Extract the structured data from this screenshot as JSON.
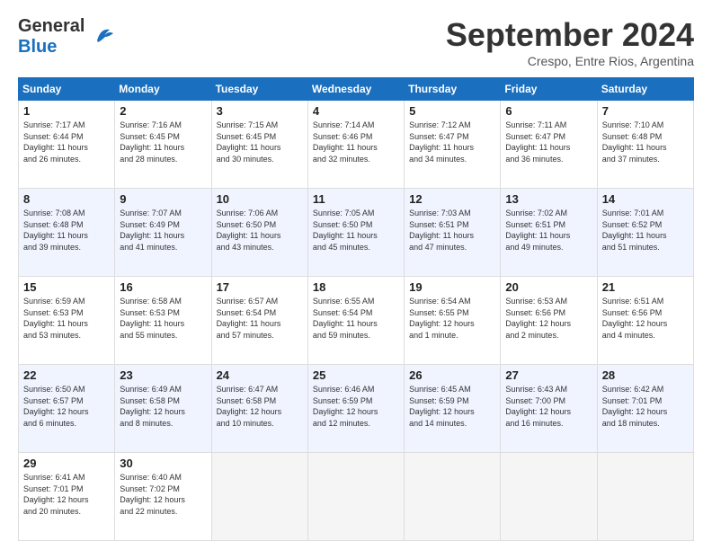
{
  "header": {
    "logo_line1": "General",
    "logo_line2": "Blue",
    "month": "September 2024",
    "location": "Crespo, Entre Rios, Argentina"
  },
  "weekdays": [
    "Sunday",
    "Monday",
    "Tuesday",
    "Wednesday",
    "Thursday",
    "Friday",
    "Saturday"
  ],
  "weeks": [
    [
      {
        "day": "1",
        "sunrise": "Sunrise: 7:17 AM",
        "sunset": "Sunset: 6:44 PM",
        "daylight": "Daylight: 11 hours",
        "daylight2": "and 26 minutes."
      },
      {
        "day": "2",
        "sunrise": "Sunrise: 7:16 AM",
        "sunset": "Sunset: 6:45 PM",
        "daylight": "Daylight: 11 hours",
        "daylight2": "and 28 minutes."
      },
      {
        "day": "3",
        "sunrise": "Sunrise: 7:15 AM",
        "sunset": "Sunset: 6:45 PM",
        "daylight": "Daylight: 11 hours",
        "daylight2": "and 30 minutes."
      },
      {
        "day": "4",
        "sunrise": "Sunrise: 7:14 AM",
        "sunset": "Sunset: 6:46 PM",
        "daylight": "Daylight: 11 hours",
        "daylight2": "and 32 minutes."
      },
      {
        "day": "5",
        "sunrise": "Sunrise: 7:12 AM",
        "sunset": "Sunset: 6:47 PM",
        "daylight": "Daylight: 11 hours",
        "daylight2": "and 34 minutes."
      },
      {
        "day": "6",
        "sunrise": "Sunrise: 7:11 AM",
        "sunset": "Sunset: 6:47 PM",
        "daylight": "Daylight: 11 hours",
        "daylight2": "and 36 minutes."
      },
      {
        "day": "7",
        "sunrise": "Sunrise: 7:10 AM",
        "sunset": "Sunset: 6:48 PM",
        "daylight": "Daylight: 11 hours",
        "daylight2": "and 37 minutes."
      }
    ],
    [
      {
        "day": "8",
        "sunrise": "Sunrise: 7:08 AM",
        "sunset": "Sunset: 6:48 PM",
        "daylight": "Daylight: 11 hours",
        "daylight2": "and 39 minutes."
      },
      {
        "day": "9",
        "sunrise": "Sunrise: 7:07 AM",
        "sunset": "Sunset: 6:49 PM",
        "daylight": "Daylight: 11 hours",
        "daylight2": "and 41 minutes."
      },
      {
        "day": "10",
        "sunrise": "Sunrise: 7:06 AM",
        "sunset": "Sunset: 6:50 PM",
        "daylight": "Daylight: 11 hours",
        "daylight2": "and 43 minutes."
      },
      {
        "day": "11",
        "sunrise": "Sunrise: 7:05 AM",
        "sunset": "Sunset: 6:50 PM",
        "daylight": "Daylight: 11 hours",
        "daylight2": "and 45 minutes."
      },
      {
        "day": "12",
        "sunrise": "Sunrise: 7:03 AM",
        "sunset": "Sunset: 6:51 PM",
        "daylight": "Daylight: 11 hours",
        "daylight2": "and 47 minutes."
      },
      {
        "day": "13",
        "sunrise": "Sunrise: 7:02 AM",
        "sunset": "Sunset: 6:51 PM",
        "daylight": "Daylight: 11 hours",
        "daylight2": "and 49 minutes."
      },
      {
        "day": "14",
        "sunrise": "Sunrise: 7:01 AM",
        "sunset": "Sunset: 6:52 PM",
        "daylight": "Daylight: 11 hours",
        "daylight2": "and 51 minutes."
      }
    ],
    [
      {
        "day": "15",
        "sunrise": "Sunrise: 6:59 AM",
        "sunset": "Sunset: 6:53 PM",
        "daylight": "Daylight: 11 hours",
        "daylight2": "and 53 minutes."
      },
      {
        "day": "16",
        "sunrise": "Sunrise: 6:58 AM",
        "sunset": "Sunset: 6:53 PM",
        "daylight": "Daylight: 11 hours",
        "daylight2": "and 55 minutes."
      },
      {
        "day": "17",
        "sunrise": "Sunrise: 6:57 AM",
        "sunset": "Sunset: 6:54 PM",
        "daylight": "Daylight: 11 hours",
        "daylight2": "and 57 minutes."
      },
      {
        "day": "18",
        "sunrise": "Sunrise: 6:55 AM",
        "sunset": "Sunset: 6:54 PM",
        "daylight": "Daylight: 11 hours",
        "daylight2": "and 59 minutes."
      },
      {
        "day": "19",
        "sunrise": "Sunrise: 6:54 AM",
        "sunset": "Sunset: 6:55 PM",
        "daylight": "Daylight: 12 hours",
        "daylight2": "and 1 minute."
      },
      {
        "day": "20",
        "sunrise": "Sunrise: 6:53 AM",
        "sunset": "Sunset: 6:56 PM",
        "daylight": "Daylight: 12 hours",
        "daylight2": "and 2 minutes."
      },
      {
        "day": "21",
        "sunrise": "Sunrise: 6:51 AM",
        "sunset": "Sunset: 6:56 PM",
        "daylight": "Daylight: 12 hours",
        "daylight2": "and 4 minutes."
      }
    ],
    [
      {
        "day": "22",
        "sunrise": "Sunrise: 6:50 AM",
        "sunset": "Sunset: 6:57 PM",
        "daylight": "Daylight: 12 hours",
        "daylight2": "and 6 minutes."
      },
      {
        "day": "23",
        "sunrise": "Sunrise: 6:49 AM",
        "sunset": "Sunset: 6:58 PM",
        "daylight": "Daylight: 12 hours",
        "daylight2": "and 8 minutes."
      },
      {
        "day": "24",
        "sunrise": "Sunrise: 6:47 AM",
        "sunset": "Sunset: 6:58 PM",
        "daylight": "Daylight: 12 hours",
        "daylight2": "and 10 minutes."
      },
      {
        "day": "25",
        "sunrise": "Sunrise: 6:46 AM",
        "sunset": "Sunset: 6:59 PM",
        "daylight": "Daylight: 12 hours",
        "daylight2": "and 12 minutes."
      },
      {
        "day": "26",
        "sunrise": "Sunrise: 6:45 AM",
        "sunset": "Sunset: 6:59 PM",
        "daylight": "Daylight: 12 hours",
        "daylight2": "and 14 minutes."
      },
      {
        "day": "27",
        "sunrise": "Sunrise: 6:43 AM",
        "sunset": "Sunset: 7:00 PM",
        "daylight": "Daylight: 12 hours",
        "daylight2": "and 16 minutes."
      },
      {
        "day": "28",
        "sunrise": "Sunrise: 6:42 AM",
        "sunset": "Sunset: 7:01 PM",
        "daylight": "Daylight: 12 hours",
        "daylight2": "and 18 minutes."
      }
    ],
    [
      {
        "day": "29",
        "sunrise": "Sunrise: 6:41 AM",
        "sunset": "Sunset: 7:01 PM",
        "daylight": "Daylight: 12 hours",
        "daylight2": "and 20 minutes."
      },
      {
        "day": "30",
        "sunrise": "Sunrise: 6:40 AM",
        "sunset": "Sunset: 7:02 PM",
        "daylight": "Daylight: 12 hours",
        "daylight2": "and 22 minutes."
      },
      null,
      null,
      null,
      null,
      null
    ]
  ]
}
